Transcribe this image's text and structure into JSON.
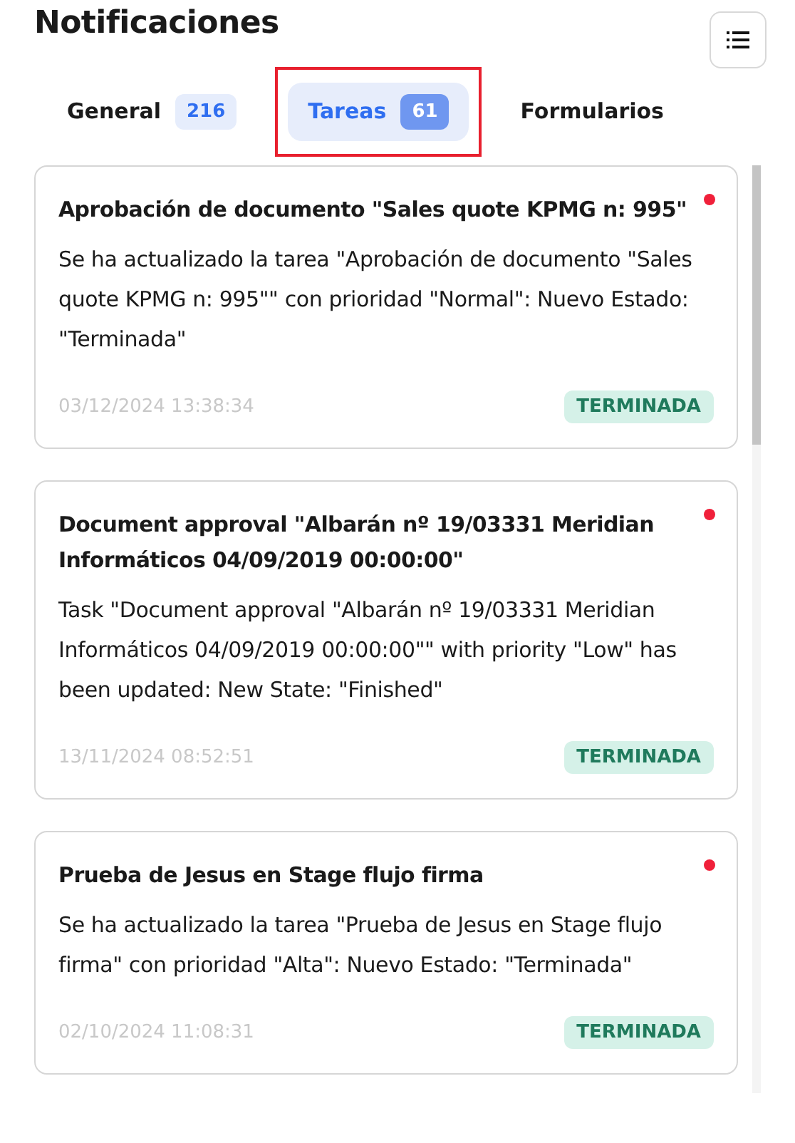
{
  "title": "Notificaciones",
  "tabs": [
    {
      "label": "General",
      "count": "216",
      "selected": false,
      "highlighted": false
    },
    {
      "label": "Tareas",
      "count": "61",
      "selected": true,
      "highlighted": true
    },
    {
      "label": "Formularios",
      "selected": false,
      "highlighted": false
    }
  ],
  "notifications": [
    {
      "title": "Aprobación de documento \"Sales quote KPMG n: 995\"",
      "unread": true,
      "body": "Se ha actualizado la tarea \"Aprobación de documento \"Sales quote KPMG n: 995\"\" con prioridad \"Normal\": Nuevo Estado: \"Terminada\"",
      "date": "03/12/2024 13:38:34",
      "status": "TERMINADA"
    },
    {
      "title": "Document approval \"Albarán nº 19/03331 Meridian Informáticos 04/09/2019 00:00:00\"",
      "unread": true,
      "body": "Task \"Document approval \"Albarán nº 19/03331 Meridian Informáticos 04/09/2019 00:00:00\"\" with priority \"Low\" has been updated: New State: \"Finished\"",
      "date": "13/11/2024 08:52:51",
      "status": "TERMINADA"
    },
    {
      "title": "Prueba de Jesus en Stage flujo firma",
      "unread": true,
      "body": "Se ha actualizado la tarea \"Prueba de Jesus en Stage flujo firma\" con prioridad \"Alta\": Nuevo Estado: \"Terminada\"",
      "date": "02/10/2024 11:08:31",
      "status": "TERMINADA"
    }
  ]
}
